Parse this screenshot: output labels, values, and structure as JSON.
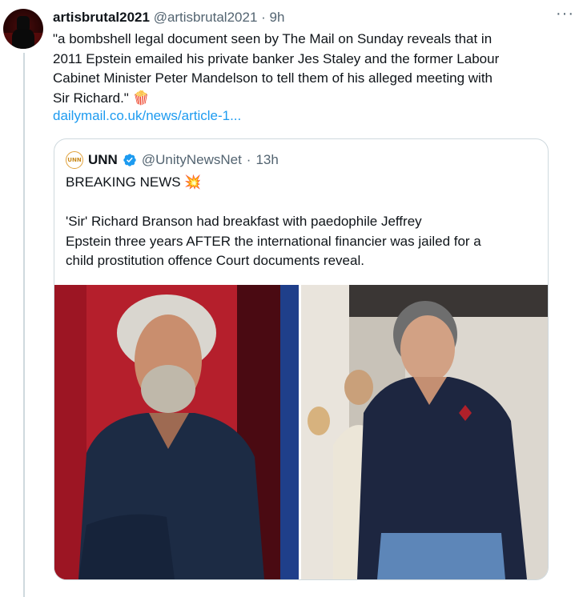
{
  "tweet": {
    "display_name": "artisbrutal2021",
    "handle": "@artisbrutal2021",
    "separator": "·",
    "time": "9h",
    "more_label": "···",
    "text_lines": [
      "\"a bombshell legal document seen by The Mail on Sunday reveals that in",
      "2011 Epstein emailed his private banker Jes Staley and the former Labour",
      "Cabinet Minister Peter Mandelson to tell them of his alleged meeting  with",
      "Sir Richard.\""
    ],
    "emoji": "🍿",
    "link": "dailymail.co.uk/news/article-1..."
  },
  "quote": {
    "avatar_text": "UNN",
    "display_name": "UNN",
    "handle": "@UnityNewsNet",
    "separator": "·",
    "time": "13h",
    "headline": "BREAKING NEWS",
    "headline_emoji": "💥",
    "body_lines": [
      "'Sir' Richard Branson had breakfast with paedophile Jeffrey",
      "Epstein three years AFTER the international financier was jailed for a",
      "child prostitution offence Court documents reveal."
    ]
  },
  "colors": {
    "link": "#1d9bf0",
    "secondary_text": "#536471",
    "verified": "#1d9bf0",
    "border": "#cfd9de"
  }
}
